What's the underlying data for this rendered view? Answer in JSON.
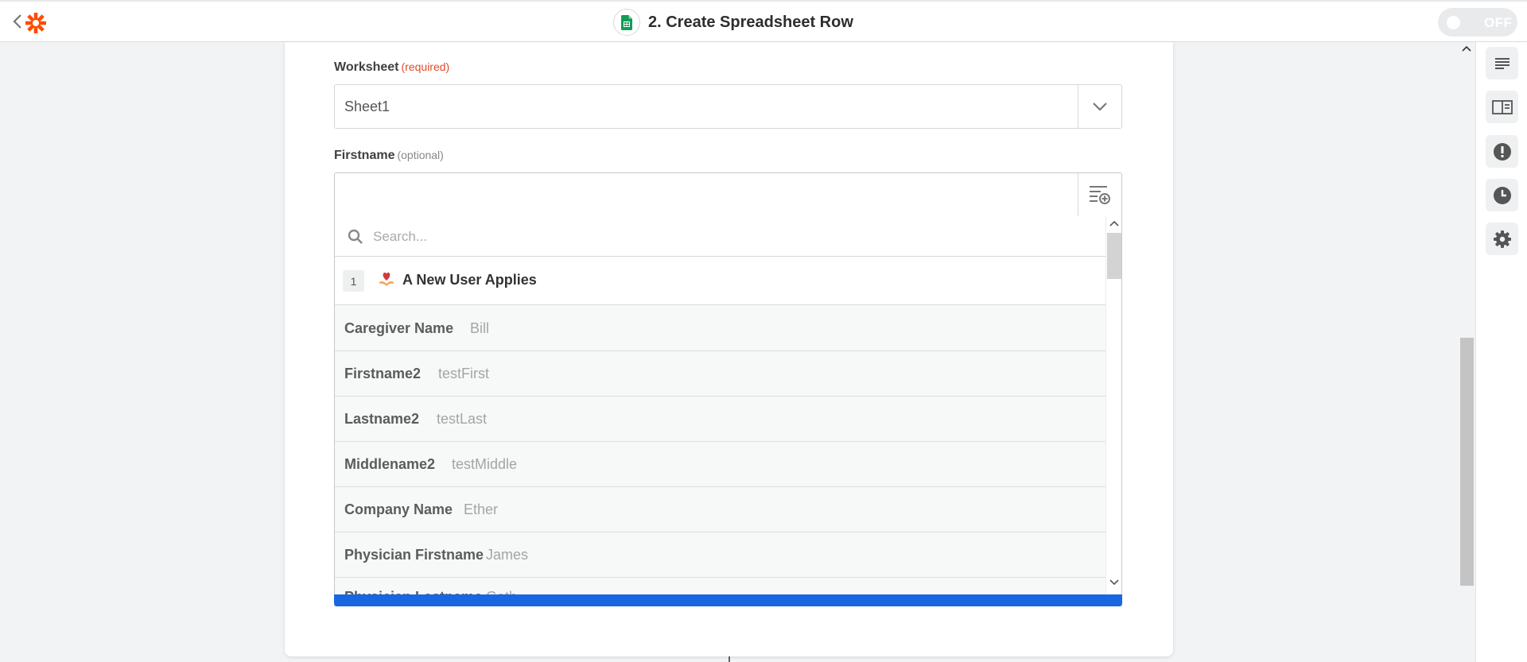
{
  "header": {
    "title": "2. Create Spreadsheet Row",
    "toggle_label": "OFF"
  },
  "worksheet": {
    "label": "Worksheet",
    "tag": "(required)",
    "value": "Sheet1"
  },
  "firstname": {
    "label": "Firstname",
    "tag": "(optional)",
    "value": ""
  },
  "dropdown": {
    "search_placeholder": "Search...",
    "group_number": "1",
    "group_name": "A New User Applies",
    "items": [
      {
        "key": "Caregiver Name",
        "value": "Bill"
      },
      {
        "key": "Firstname2",
        "value": "testFirst"
      },
      {
        "key": "Lastname2",
        "value": "testLast"
      },
      {
        "key": "Middlename2",
        "value": "testMiddle"
      },
      {
        "key": "Company Name",
        "value": "Ether"
      },
      {
        "key": "Physician Firstname",
        "value": "James"
      },
      {
        "key": "Physician Lastname",
        "value": "Gath"
      }
    ]
  },
  "colors": {
    "brand": "#ff4a00",
    "accent": "#1866e1",
    "required": "#e24a2b",
    "sheets_green": "#0f9d58"
  },
  "icons": {
    "back": "chevron-left-icon",
    "logo": "zapier-asterisk-icon",
    "app": "google-sheets-icon",
    "select": "chevron-down-icon",
    "insert": "insert-data-icon",
    "search": "search-icon",
    "group": "heart-hand-icon",
    "rail": [
      "details-icon",
      "guide-icon",
      "alert-icon",
      "history-icon",
      "settings-icon"
    ]
  }
}
